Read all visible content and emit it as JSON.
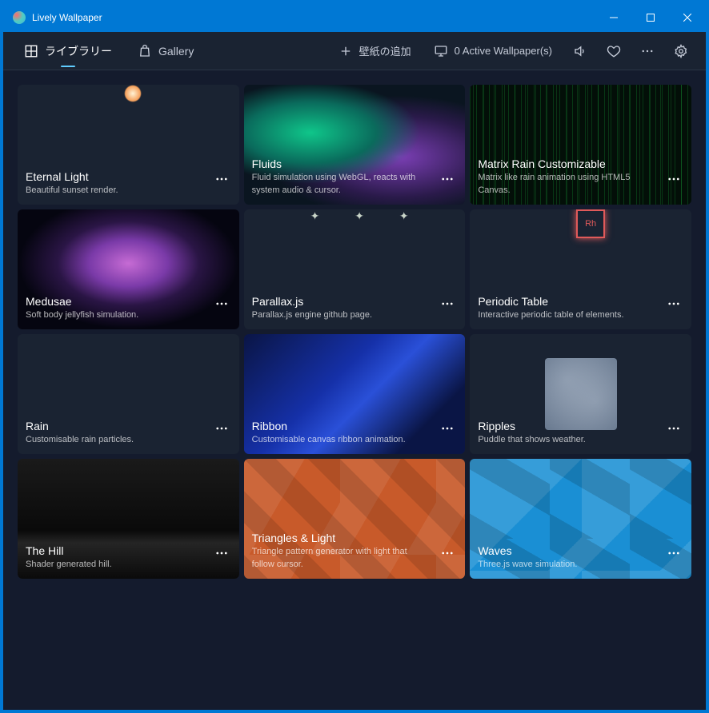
{
  "window": {
    "title": "Lively Wallpaper"
  },
  "tabs": {
    "library": "ライブラリー",
    "gallery": "Gallery"
  },
  "toolbar": {
    "add_label": "壁紙の追加",
    "active_label": "0 Active Wallpaper(s)"
  },
  "cards": [
    {
      "title": "Eternal Light",
      "desc": "Beautiful sunset render."
    },
    {
      "title": "Fluids",
      "desc": "Fluid simulation using WebGL, reacts with system audio & cursor."
    },
    {
      "title": "Matrix Rain Customizable",
      "desc": "Matrix like rain animation using HTML5 Canvas."
    },
    {
      "title": "Medusae",
      "desc": "Soft body jellyfish simulation."
    },
    {
      "title": "Parallax.js",
      "desc": "Parallax.js engine github page."
    },
    {
      "title": "Periodic Table",
      "desc": "Interactive periodic table of elements."
    },
    {
      "title": "Rain",
      "desc": "Customisable rain particles."
    },
    {
      "title": "Ribbon",
      "desc": "Customisable canvas ribbon animation."
    },
    {
      "title": "Ripples",
      "desc": "Puddle that shows weather."
    },
    {
      "title": "The Hill",
      "desc": "Shader generated hill."
    },
    {
      "title": "Triangles & Light",
      "desc": "Triangle pattern generator with light that follow cursor."
    },
    {
      "title": "Waves",
      "desc": "Three.js wave simulation."
    }
  ]
}
